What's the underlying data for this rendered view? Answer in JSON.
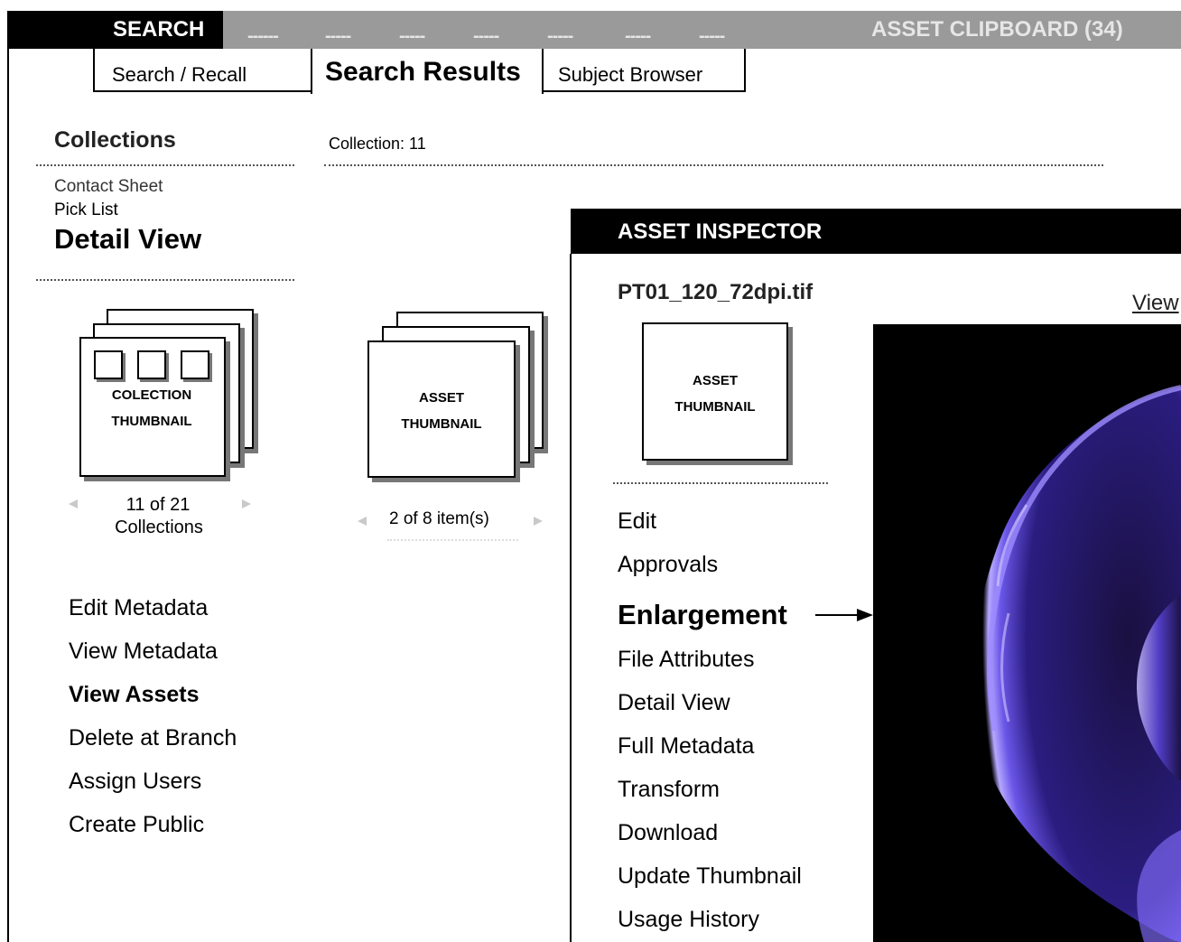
{
  "topnav": {
    "search_tab": "SEARCH",
    "placeholders": [
      "------",
      "-----",
      "-----",
      "-----",
      "-----",
      "-----",
      "-----"
    ],
    "clipboard": "ASSET CLIPBOARD (34)"
  },
  "subtabs": {
    "search_recall": "Search / Recall",
    "search_results": "Search Results",
    "subject_browser": "Subject Browser"
  },
  "sidebar": {
    "collections_title": "Collections",
    "views": {
      "contact_sheet": "Contact Sheet",
      "pick_list": "Pick List",
      "detail_view": "Detail View"
    },
    "collection_thumb": {
      "line1": "COLECTION",
      "line2": "THUMBNAIL",
      "pager_line1": "11 of  21",
      "pager_line2": "Collections"
    },
    "actions": {
      "edit_metadata": "Edit Metadata",
      "view_metadata": "View Metadata",
      "view_assets": "View Assets",
      "delete_at_branch": "Delete at Branch",
      "assign_users": "Assign Users",
      "create_public": "Create Public"
    }
  },
  "main": {
    "collection_label": "Collection: 11",
    "asset_thumb": {
      "line1": "ASSET",
      "line2": "THUMBNAIL",
      "pager": "2 of  8 item(s)"
    }
  },
  "inspector": {
    "title": "ASSET INSPECTOR",
    "filename": "PT01_120_72dpi.tif",
    "view_link": "View",
    "thumb_line1": "ASSET",
    "thumb_line2": "THUMBNAIL",
    "menu": {
      "edit": "Edit",
      "approvals": "Approvals",
      "enlargement": "Enlargement",
      "file_attributes": "File Attributes",
      "detail_view": "Detail View",
      "full_metadata": "Full Metadata",
      "transform": "Transform",
      "download": "Download",
      "update_thumbnail": "Update Thumbnail",
      "usage_history": "Usage History"
    }
  },
  "colors": {
    "nav_bar": "#9a9a9a",
    "nav_active": "#000000",
    "image_glow": "#6a56e8"
  },
  "icons": [
    "left-arrow-icon",
    "right-arrow-icon",
    "pointer-arrow-icon"
  ]
}
